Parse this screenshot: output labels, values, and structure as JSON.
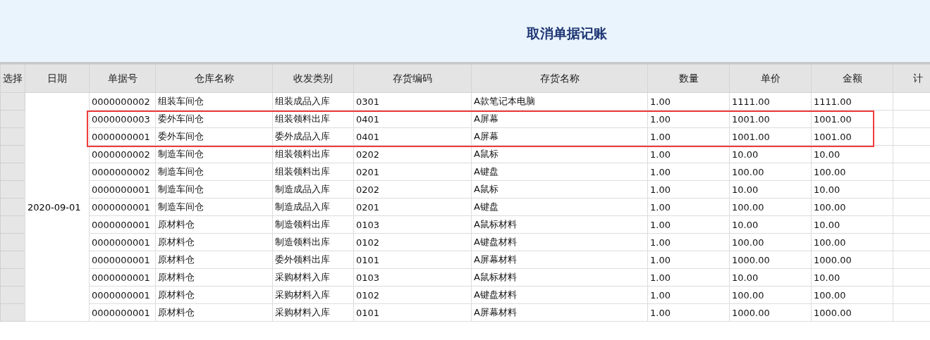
{
  "title": "取消单据记账",
  "columns": [
    "选择",
    "日期",
    "单据号",
    "仓库名称",
    "收发类别",
    "存货编码",
    "存货名称",
    "数量",
    "单价",
    "金额",
    "计"
  ],
  "date": "2020-09-01",
  "rows": [
    {
      "cells": [
        "0000000002",
        "组装车间仓",
        "组装成品入库",
        "0301",
        "A款笔记本电脑",
        "1.00",
        "1111.00",
        "1111.00"
      ],
      "highlighted": false
    },
    {
      "cells": [
        "0000000003",
        "委外车间仓",
        "组装领料出库",
        "0401",
        "A屏幕",
        "1.00",
        "1001.00",
        "1001.00"
      ],
      "highlighted": true
    },
    {
      "cells": [
        "0000000001",
        "委外车间仓",
        "委外成品入库",
        "0401",
        "A屏幕",
        "1.00",
        "1001.00",
        "1001.00"
      ],
      "highlighted": true
    },
    {
      "cells": [
        "0000000002",
        "制造车间仓",
        "组装领料出库",
        "0202",
        "A鼠标",
        "1.00",
        "10.00",
        "10.00"
      ],
      "highlighted": false
    },
    {
      "cells": [
        "0000000002",
        "制造车间仓",
        "组装领料出库",
        "0201",
        "A键盘",
        "1.00",
        "100.00",
        "100.00"
      ],
      "highlighted": false
    },
    {
      "cells": [
        "0000000001",
        "制造车间仓",
        "制造成品入库",
        "0202",
        "A鼠标",
        "1.00",
        "10.00",
        "10.00"
      ],
      "highlighted": false
    },
    {
      "cells": [
        "0000000001",
        "制造车间仓",
        "制造成品入库",
        "0201",
        "A键盘",
        "1.00",
        "100.00",
        "100.00"
      ],
      "highlighted": false
    },
    {
      "cells": [
        "0000000001",
        "原材料仓",
        "制造领料出库",
        "0103",
        "A鼠标材料",
        "1.00",
        "10.00",
        "10.00"
      ],
      "highlighted": false
    },
    {
      "cells": [
        "0000000001",
        "原材料仓",
        "制造领料出库",
        "0102",
        "A键盘材料",
        "1.00",
        "100.00",
        "100.00"
      ],
      "highlighted": false
    },
    {
      "cells": [
        "0000000001",
        "原材料仓",
        "委外领料出库",
        "0101",
        "A屏幕材料",
        "1.00",
        "1000.00",
        "1000.00"
      ],
      "highlighted": false
    },
    {
      "cells": [
        "0000000001",
        "原材料仓",
        "采购材料入库",
        "0103",
        "A鼠标材料",
        "1.00",
        "10.00",
        "10.00"
      ],
      "highlighted": false
    },
    {
      "cells": [
        "0000000001",
        "原材料仓",
        "采购材料入库",
        "0102",
        "A键盘材料",
        "1.00",
        "100.00",
        "100.00"
      ],
      "highlighted": false
    },
    {
      "cells": [
        "0000000001",
        "原材料仓",
        "采购材料入库",
        "0101",
        "A屏幕材料",
        "1.00",
        "1000.00",
        "1000.00"
      ],
      "highlighted": false
    }
  ]
}
